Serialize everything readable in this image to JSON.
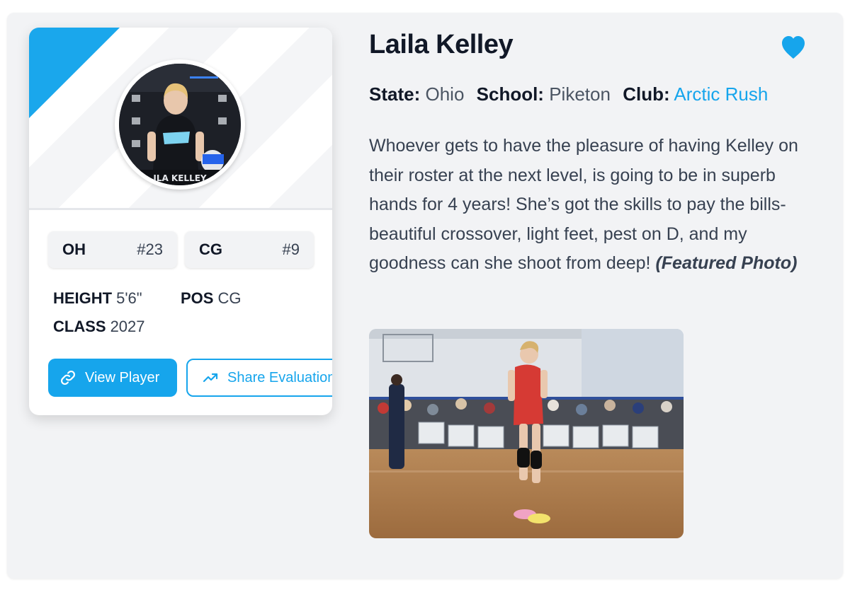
{
  "player": {
    "name": "Laila Kelley",
    "state_label": "State:",
    "state": "Ohio",
    "school_label": "School:",
    "school": "Piketon",
    "club_label": "Club:",
    "club": "Arctic Rush"
  },
  "card": {
    "tags": [
      {
        "key": "OH",
        "value": "#23"
      },
      {
        "key": "CG",
        "value": "#9"
      }
    ],
    "stats": {
      "height_label": "HEIGHT",
      "height": "5'6\"",
      "pos_label": "POS",
      "pos": "CG",
      "class_label": "CLASS",
      "class": "2027"
    },
    "avatar_caption": "ILA KELLEY",
    "buttons": {
      "view": "View Player",
      "share": "Share Evaluation"
    }
  },
  "evaluation": {
    "text": "Whoever gets to have the pleasure of having Kelley on their roster at the next level, is going to be in superb hands for 4 years! She’s got the skills to pay the bills- beautiful crossover, light feet, pest on D, and my goodness can she shoot from deep! ",
    "note": "(Featured Photo)"
  },
  "colors": {
    "accent": "#16a5ec",
    "panel": "#f2f3f5",
    "heading": "#111827"
  },
  "icons": {
    "favorite": "heart-icon",
    "view": "link-icon",
    "share": "trending-up-icon"
  }
}
